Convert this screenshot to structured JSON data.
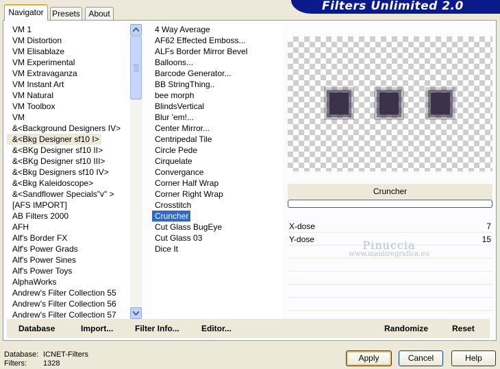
{
  "app": {
    "title": "Filters Unlimited 2.0"
  },
  "tabs": [
    {
      "label": "Navigator",
      "active": true
    },
    {
      "label": "Presets",
      "active": false
    },
    {
      "label": "About",
      "active": false
    }
  ],
  "categories": [
    "VM 1",
    "VM Distortion",
    "VM Elisablaze",
    "VM Experimental",
    "VM Extravaganza",
    "VM Instant Art",
    "VM Natural",
    "VM Toolbox",
    "VM",
    "&<Background Designers IV>",
    "&<Bkg Designer sf10 I>",
    "&<BKg Designer sf10 II>",
    "&<BKg Designer sf10 III>",
    "&<Bkg Designers sf10 IV>",
    "&<Bkg Kaleidoscope>",
    "&<Sandflower Specials\"v\" >",
    "[AFS IMPORT]",
    "AB Filters 2000",
    "AFH",
    "Alf's Border FX",
    "Alf's Power Grads",
    "Alf's Power Sines",
    "Alf's Power Toys",
    "AlphaWorks",
    "Andrew's Filter Collection 55",
    "Andrew's Filter Collection 56",
    "Andrew's Filter Collection 57"
  ],
  "selected_category": "&<Bkg Designer sf10 I>",
  "filters": [
    "4 Way Average",
    "AF62 Effected Emboss...",
    "ALFs Border Mirror Bevel",
    "Balloons...",
    "Barcode Generator...",
    "BB StringThing..",
    "bee morph",
    "BlindsVertical",
    "Blur 'em!...",
    "Center Mirror...",
    "Centripedal Tile",
    "Circle Pede",
    "Cirquelate",
    "Convergance",
    "Corner Half Wrap",
    "Corner Right Wrap",
    "Crosstitch",
    "Cruncher",
    "Cut Glass  BugEye",
    "Cut Glass 03",
    "Dice It"
  ],
  "selected_filter": "Cruncher",
  "preview": {
    "filter_name": "Cruncher",
    "progress_percent": 0,
    "square_color": "#3b3349"
  },
  "params": [
    {
      "label": "X-dose",
      "value": "7"
    },
    {
      "label": "Y-dose",
      "value": "15"
    }
  ],
  "watermark": {
    "line1": "Pinuccia",
    "line2": "www.maidiregrafica.eu"
  },
  "toolbar": {
    "database": "Database",
    "import": "Import...",
    "filter_info": "Filter Info...",
    "editor": "Editor...",
    "randomize": "Randomize",
    "reset": "Reset"
  },
  "status": {
    "database_label": "Database:",
    "database_value": "ICNET-Filters",
    "filters_label": "Filters:",
    "filters_value": "1328"
  },
  "buttons": {
    "apply": "Apply",
    "cancel": "Cancel",
    "help": "Help"
  },
  "colors": {
    "banner": "#0a1a8a",
    "selection": "#316ac5",
    "accent_tab": "#f5a623"
  }
}
